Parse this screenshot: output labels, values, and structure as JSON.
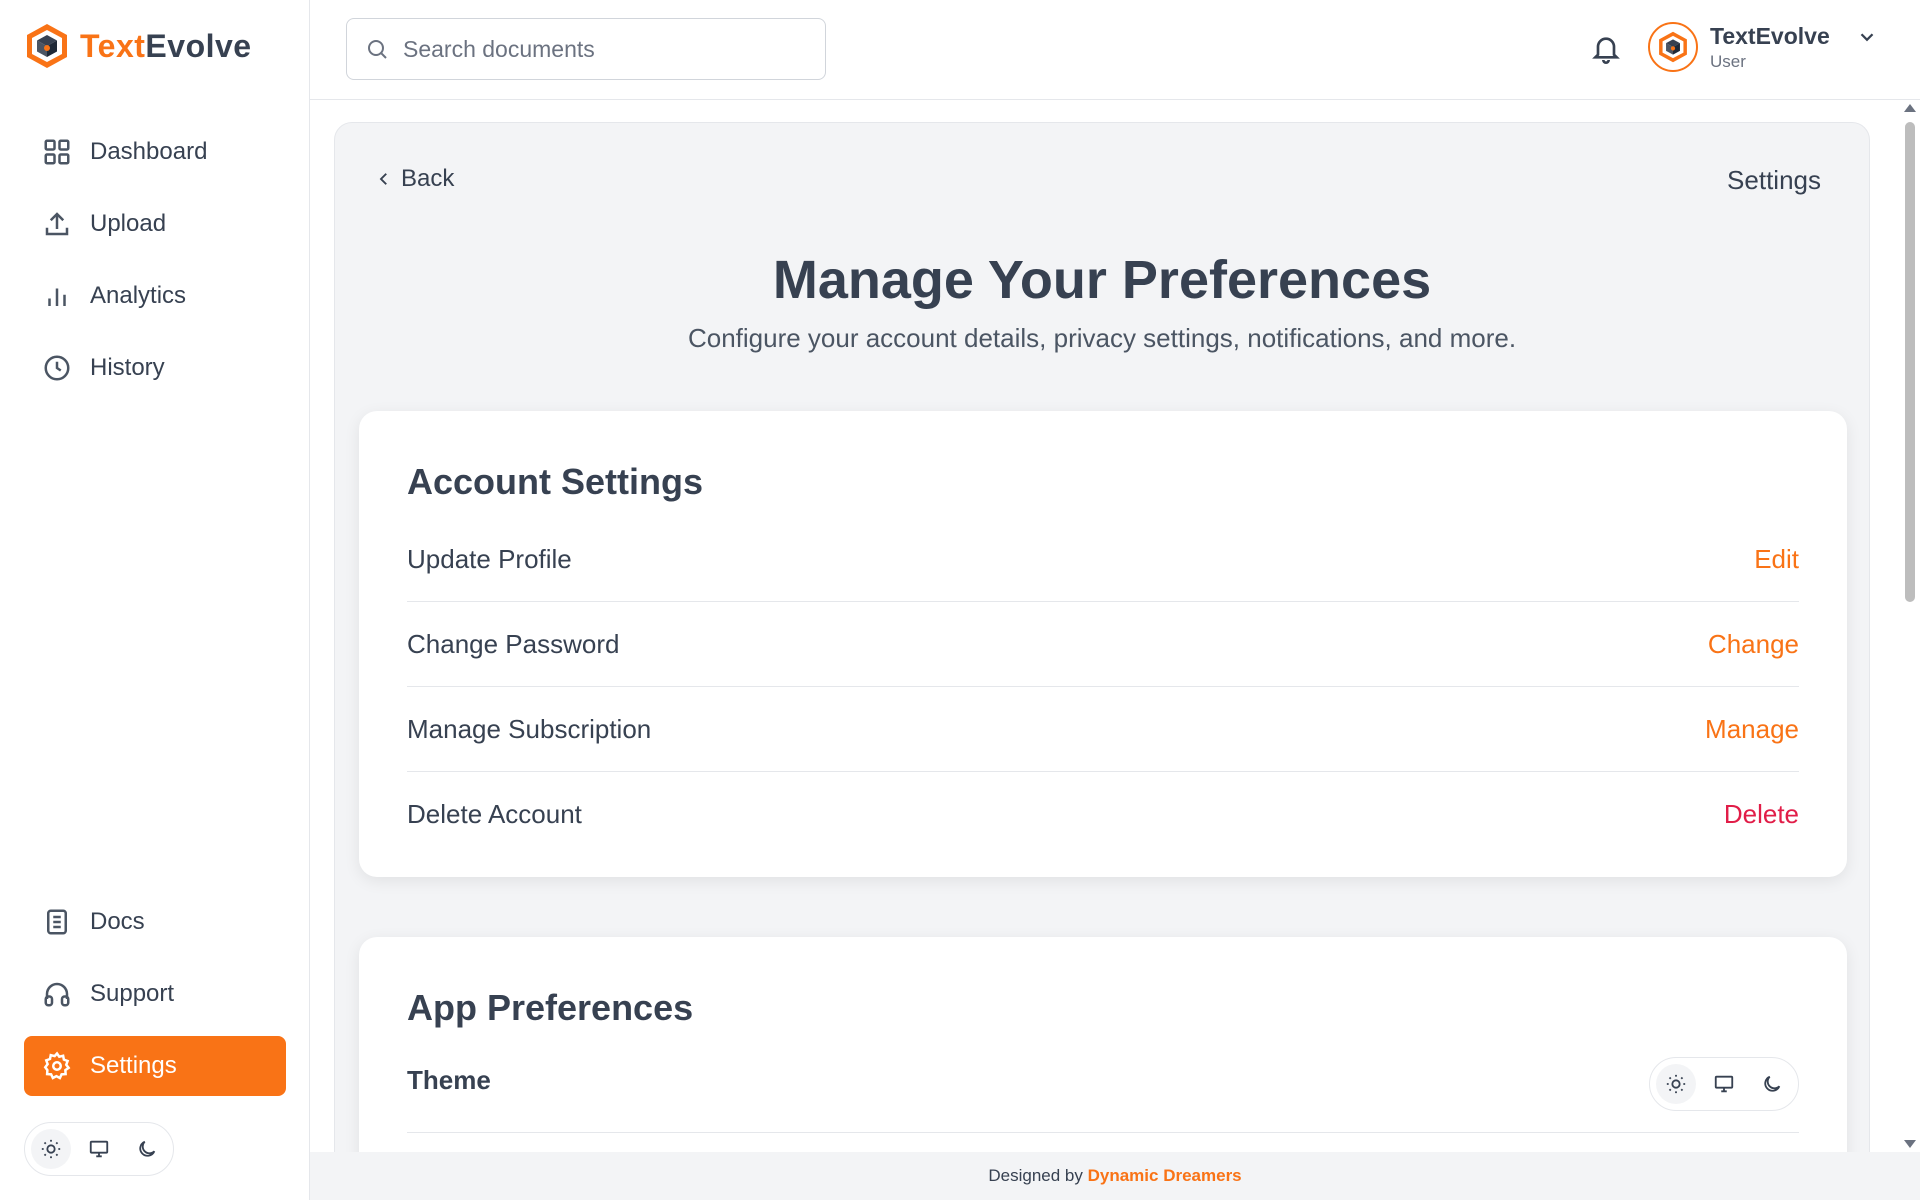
{
  "brand": {
    "name_part1": "Text",
    "name_part2": "Evolve",
    "accent_color": "#f97316",
    "logo_icon": "hexagon-cube-logo"
  },
  "search": {
    "placeholder": "Search documents",
    "value": ""
  },
  "user": {
    "name": "TextEvolve",
    "role": "User"
  },
  "sidebar": {
    "top_items": [
      {
        "label": "Dashboard",
        "icon": "grid-icon"
      },
      {
        "label": "Upload",
        "icon": "upload-icon"
      },
      {
        "label": "Analytics",
        "icon": "bar-chart-icon"
      },
      {
        "label": "History",
        "icon": "clock-icon"
      }
    ],
    "bottom_items": [
      {
        "label": "Docs",
        "icon": "document-icon"
      },
      {
        "label": "Support",
        "icon": "headphones-icon"
      },
      {
        "label": "Settings",
        "icon": "gear-icon",
        "active": true
      }
    ],
    "theme_options": [
      "light",
      "system",
      "dark"
    ],
    "theme_selected": "light"
  },
  "page": {
    "back_label": "Back",
    "breadcrumb": "Settings",
    "title": "Manage Your Preferences",
    "subtitle": "Configure your account details, privacy settings, notifications, and more."
  },
  "account_settings": {
    "title": "Account Settings",
    "rows": [
      {
        "label": "Update Profile",
        "action": "Edit",
        "danger": false
      },
      {
        "label": "Change Password",
        "action": "Change",
        "danger": false
      },
      {
        "label": "Manage Subscription",
        "action": "Manage",
        "danger": false
      },
      {
        "label": "Delete Account",
        "action": "Delete",
        "danger": true
      }
    ],
    "danger_color": "#e11d48"
  },
  "app_preferences": {
    "title": "App Preferences",
    "theme_label": "Theme",
    "theme_selected": "light"
  },
  "footer": {
    "prefix": "Designed by",
    "brand": "Dynamic Dreamers"
  }
}
